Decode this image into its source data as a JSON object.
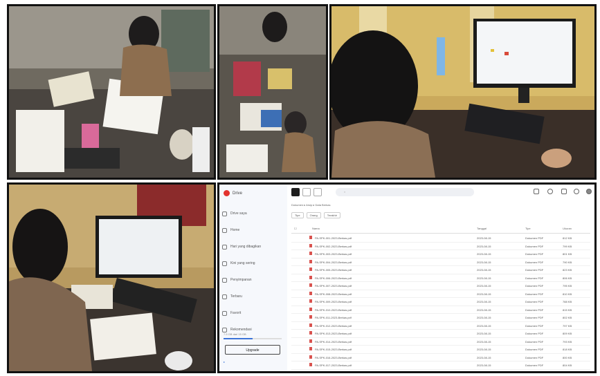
{
  "collage": {
    "panels": [
      {
        "scene": "officer-writing-documents"
      },
      {
        "scene": "officer-at-cluttered-desk"
      },
      {
        "scene": "officer-at-computer-monitor"
      },
      {
        "scene": "officer-at-workstation"
      }
    ]
  },
  "drive": {
    "app_name": "Drive",
    "nav": [
      "Drive saya",
      "Home",
      "Hari yang dibagikan",
      "Kini yang sering",
      "Penyimpanan",
      "Terbaru",
      "Favorit",
      "Rekomendasi"
    ],
    "upgrade_label": "Upgrade",
    "storage_text": "7.5 GB dari 15 GB",
    "breadcrumb": "Dokumen ▸ Arsip ▸ Data Berkas",
    "filters": [
      "Tipe",
      "Orang",
      "Terakhir"
    ],
    "columns": [
      "Nama",
      "Tanggal",
      "Tipe",
      "Ukuran"
    ],
    "rows": [
      {
        "name": "PA-SPK-001-2023-Berkas.pdf",
        "date": "2023-08-15",
        "type": "Dokumen PDF",
        "size": "812 KB"
      },
      {
        "name": "PA-SPK-002-2023-Berkas.pdf",
        "date": "2023-08-15",
        "type": "Dokumen PDF",
        "size": "799 KB"
      },
      {
        "name": "PA-SPK-003-2023-Berkas.pdf",
        "date": "2023-08-15",
        "type": "Dokumen PDF",
        "size": "801 KB"
      },
      {
        "name": "PA-SPK-004-2023-Berkas.pdf",
        "date": "2023-08-15",
        "type": "Dokumen PDF",
        "size": "790 KB"
      },
      {
        "name": "PA-SPK-005-2023-Berkas.pdf",
        "date": "2023-08-15",
        "type": "Dokumen PDF",
        "size": "823 KB"
      },
      {
        "name": "PA-SPK-006-2023-Berkas.pdf",
        "date": "2023-08-15",
        "type": "Dokumen PDF",
        "size": "806 KB"
      },
      {
        "name": "PA-SPK-007-2023-Berkas.pdf",
        "date": "2023-08-15",
        "type": "Dokumen PDF",
        "size": "795 KB"
      },
      {
        "name": "PA-SPK-008-2023-Berkas.pdf",
        "date": "2023-08-15",
        "type": "Dokumen PDF",
        "size": "810 KB"
      },
      {
        "name": "PA-SPK-009-2023-Berkas.pdf",
        "date": "2023-08-15",
        "type": "Dokumen PDF",
        "size": "788 KB"
      },
      {
        "name": "PA-SPK-010-2023-Berkas.pdf",
        "date": "2023-08-15",
        "type": "Dokumen PDF",
        "size": "815 KB"
      },
      {
        "name": "PA-SPK-011-2023-Berkas.pdf",
        "date": "2023-08-15",
        "type": "Dokumen PDF",
        "size": "802 KB"
      },
      {
        "name": "PA-SPK-012-2023-Berkas.pdf",
        "date": "2023-08-15",
        "type": "Dokumen PDF",
        "size": "797 KB"
      },
      {
        "name": "PA-SPK-013-2023-Berkas.pdf",
        "date": "2023-08-15",
        "type": "Dokumen PDF",
        "size": "809 KB"
      },
      {
        "name": "PA-SPK-014-2023-Berkas.pdf",
        "date": "2023-08-15",
        "type": "Dokumen PDF",
        "size": "793 KB"
      },
      {
        "name": "PA-SPK-015-2023-Berkas.pdf",
        "date": "2023-08-15",
        "type": "Dokumen PDF",
        "size": "818 KB"
      },
      {
        "name": "PA-SPK-016-2023-Berkas.pdf",
        "date": "2023-08-15",
        "type": "Dokumen PDF",
        "size": "800 KB"
      },
      {
        "name": "PA-SPK-017-2023-Berkas.pdf",
        "date": "2023-08-15",
        "type": "Dokumen PDF",
        "size": "804 KB"
      },
      {
        "name": "PA-SPK-018-2023-Berkas.pdf",
        "date": "2023-08-15",
        "type": "Dokumen PDF",
        "size": "811 KB"
      },
      {
        "name": "PA-SPK-019-2023-Berkas.pdf",
        "date": "2023-08-15",
        "type": "Dokumen PDF",
        "size": "798 KB"
      }
    ]
  }
}
